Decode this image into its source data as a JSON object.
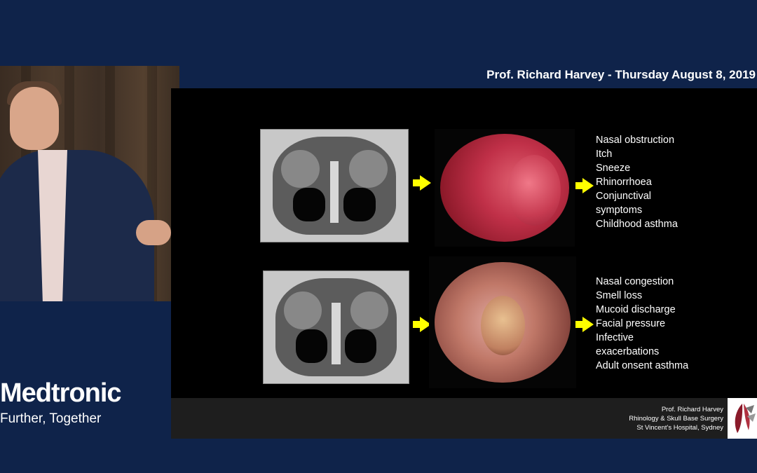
{
  "header": {
    "title": "Prof. Richard Harvey - Thursday August 8, 2019"
  },
  "brand": {
    "name": "Medtronic",
    "tagline": "Further, Together"
  },
  "slide": {
    "rows": [
      {
        "symptoms": [
          "Nasal obstruction",
          "Itch",
          "Sneeze",
          "Rhinorrhoea",
          "Conjunctival",
          "symptoms",
          "Childhood asthma"
        ]
      },
      {
        "symptoms": [
          "Nasal congestion",
          "Smell loss",
          "Mucoid discharge",
          "Facial pressure",
          "Infective",
          "exacerbations",
          "Adult onsent asthma"
        ]
      }
    ],
    "credit": {
      "name": "Prof. Richard Harvey",
      "title": "Rhinology & Skull Base Surgery",
      "affiliation": "St Vincent's Hospital, Sydney"
    }
  },
  "colors": {
    "background": "#0f234a",
    "arrow": "#ffff00",
    "slide": "#000000"
  },
  "icons": {
    "cursor": "mouse-cursor-icon",
    "arrow": "arrow-right-icon",
    "logo": "hospital-logo-icon"
  }
}
